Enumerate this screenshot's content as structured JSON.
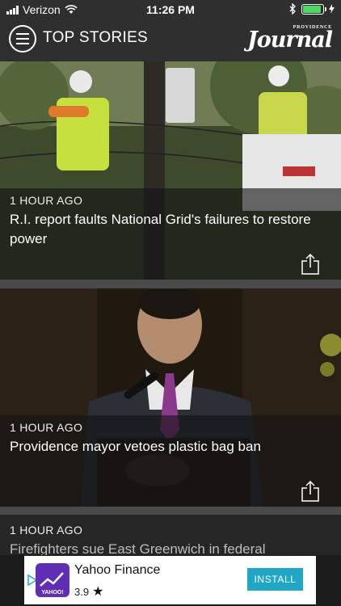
{
  "status_bar": {
    "carrier": "Verizon",
    "time": "11:26 PM",
    "battery_level": 0.9
  },
  "nav": {
    "title": "TOP STORIES",
    "logo_small": "PROVIDENCE",
    "logo_main": "Journal"
  },
  "stories": [
    {
      "time": "1 HOUR AGO",
      "title": "R.I. report faults National Grid's failures to restore power"
    },
    {
      "time": "1 HOUR AGO",
      "title": "Providence mayor vetoes plastic bag ban"
    },
    {
      "time": "1 HOUR AGO",
      "title": "Firefighters sue East Greenwich in federal"
    }
  ],
  "ad": {
    "app_name": "Yahoo Finance",
    "rating": "3.9",
    "icon_label": "YAHOO!",
    "install_label": "INSTALL"
  },
  "colors": {
    "bar_background": "#2f2f2f",
    "install_button": "#20a6c6",
    "ad_icon": "#5f2eb5",
    "battery": "#4cd964"
  },
  "icons": [
    "signal-icon",
    "wifi-icon",
    "bluetooth-icon",
    "battery-icon",
    "charging-icon",
    "menu-icon",
    "share-icon",
    "star-icon",
    "adchoices-icon"
  ]
}
